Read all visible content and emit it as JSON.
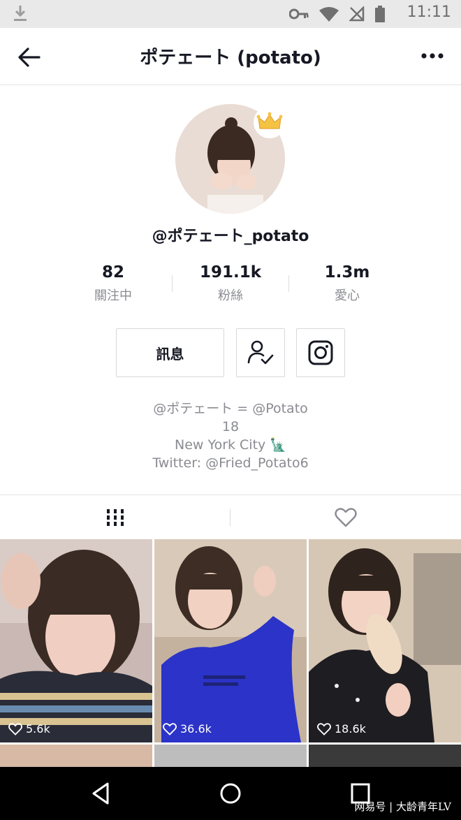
{
  "status_bar": {
    "time": "11:11"
  },
  "header": {
    "title": "ポテェート (potato)"
  },
  "profile": {
    "username": "@ポテェート_potato",
    "stats": [
      {
        "value": "82",
        "label": "關注中"
      },
      {
        "value": "191.1k",
        "label": "粉絲"
      },
      {
        "value": "1.3m",
        "label": "愛心"
      }
    ],
    "message_button": "訊息",
    "bio": {
      "line1": "@ポテェート = @Potato",
      "line2": "18",
      "line3": "New York City 🗽",
      "line4": "Twitter: @Fried_Potato6"
    }
  },
  "videos": [
    {
      "likes": "5.6k"
    },
    {
      "likes": "36.6k"
    },
    {
      "likes": "18.6k"
    }
  ],
  "watermark": "网易号 | 大龄青年LV"
}
